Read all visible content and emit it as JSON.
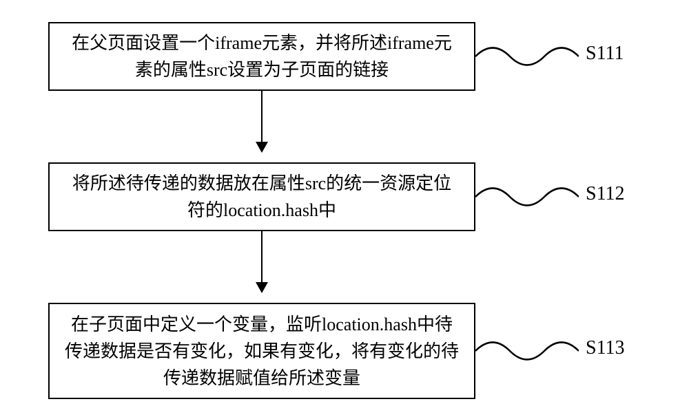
{
  "steps": [
    {
      "text": "在父页面设置一个iframe元素，并将所述iframe元素的属性src设置为子页面的链接",
      "label": "S111"
    },
    {
      "text": "将所述待传递的数据放在属性src的统一资源定位符的location.hash中",
      "label": "S112"
    },
    {
      "text": "在子页面中定义一个变量，监听location.hash中待传递数据是否有变化，如果有变化，将有变化的待传递数据赋值给所述变量",
      "label": "S113"
    }
  ]
}
